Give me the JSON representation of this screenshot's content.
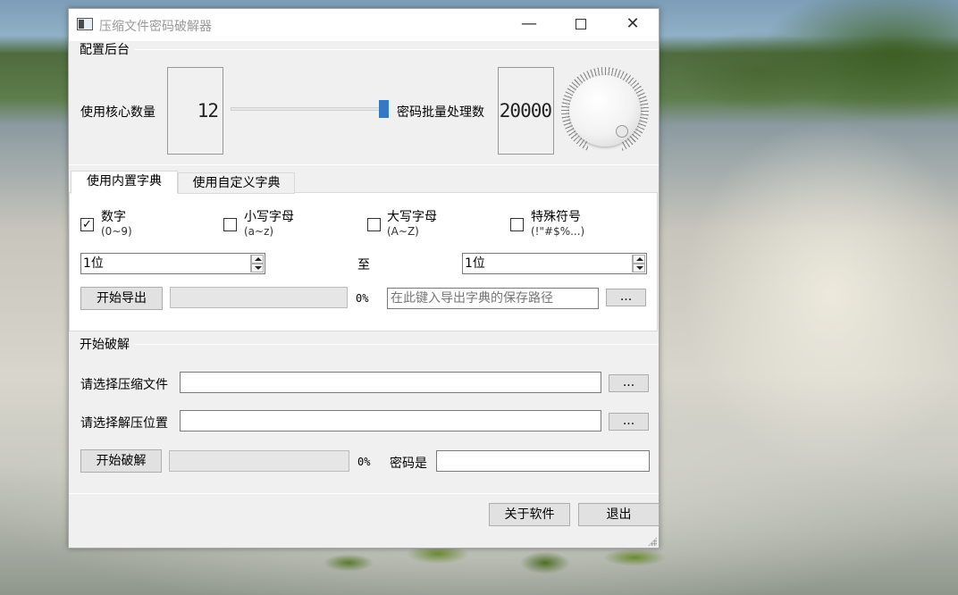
{
  "window": {
    "title": "压缩文件密码破解器"
  },
  "config": {
    "group_title": "配置后台",
    "cores_label": "使用核心数量",
    "cores_value": "12",
    "slider_value": 12,
    "batch_label": "密码批量处理数",
    "batch_value": "20000"
  },
  "tabs": [
    {
      "label": "使用内置字典",
      "active": true
    },
    {
      "label": "使用自定义字典",
      "active": false
    }
  ],
  "dict": {
    "options": [
      {
        "label": "数字",
        "sub": "(0~9)",
        "checked": true
      },
      {
        "label": "小写字母",
        "sub": "(a~z)",
        "checked": false
      },
      {
        "label": "大写字母",
        "sub": "(A~Z)",
        "checked": false
      },
      {
        "label": "特殊符号",
        "sub": "(!\"#$%...)",
        "checked": false
      }
    ],
    "length_from": "1位",
    "range_label": "至",
    "length_to": "1位",
    "export_button": "开始导出",
    "export_progress_text": "0%",
    "export_progress": 0,
    "export_path_placeholder": "在此键入导出字典的保存路径",
    "browse_label": "..."
  },
  "crack": {
    "group_title": "开始破解",
    "archive_label": "请选择压缩文件",
    "archive_value": "",
    "extract_label": "请选择解压位置",
    "extract_value": "",
    "browse_label": "...",
    "start_button": "开始破解",
    "progress_text": "0%",
    "progress": 0,
    "password_label": "密码是",
    "password_value": ""
  },
  "footer": {
    "about_button": "关于软件",
    "exit_button": "退出"
  }
}
